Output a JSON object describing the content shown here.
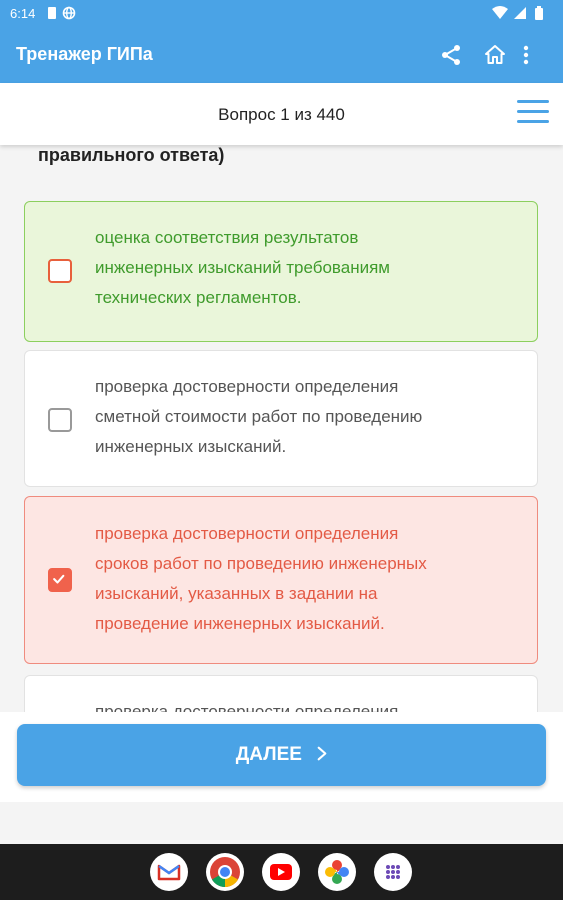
{
  "status_bar": {
    "time": "6:14"
  },
  "app_bar": {
    "title": "Тренажер ГИПа",
    "actions": [
      "share-icon",
      "home-icon",
      "more-vert-icon"
    ]
  },
  "question_header": {
    "counter": "Вопрос 1 из 440",
    "menu_icon": "hamburger-menu-icon"
  },
  "question": {
    "text_tail": "правильного ответа)"
  },
  "options": [
    {
      "state": "correct",
      "checked": false,
      "lines": [
        "оценка соответствия результатов",
        "инженерных изысканий требованиям",
        "технических регламентов."
      ]
    },
    {
      "state": "neutral",
      "checked": false,
      "lines": [
        "проверка достоверности определения",
        "сметной стоимости работ по проведению",
        "инженерных изысканий."
      ]
    },
    {
      "state": "wrong",
      "checked": true,
      "lines": [
        "проверка достоверности определения",
        "сроков работ по проведению инженерных",
        "изысканий, указанных в задании на",
        "проведение инженерных изысканий."
      ]
    },
    {
      "state": "neutral",
      "checked": false,
      "lines": [
        "проверка достоверности определения"
      ]
    }
  ],
  "next_button": {
    "label": "ДАЛЕЕ"
  },
  "colors": {
    "primary": "#4aa3e6",
    "correct": "#3f9b2c",
    "wrong": "#e35a45"
  },
  "dock_apps": [
    "gmail-icon",
    "chrome-icon",
    "youtube-icon",
    "photos-icon",
    "app-drawer-icon"
  ]
}
